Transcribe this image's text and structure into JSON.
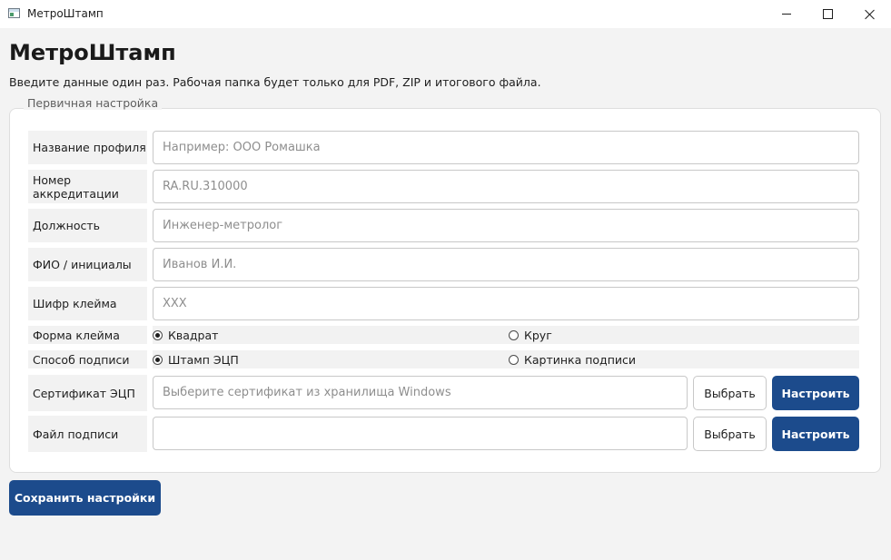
{
  "window": {
    "title": "МетроШтамп"
  },
  "header": {
    "title": "МетроШтамп",
    "subtitle": "Введите данные один раз. Рабочая папка будет только для PDF, ZIP и итогового файла."
  },
  "group": {
    "legend": "Первичная настройка"
  },
  "fields": {
    "profile": {
      "label": "Название профиля",
      "value": "",
      "placeholder": "Например: ООО Ромашка"
    },
    "accreditation": {
      "label": "Номер аккредитации",
      "value": "",
      "placeholder": "RA.RU.310000"
    },
    "position": {
      "label": "Должность",
      "value": "",
      "placeholder": "Инженер-метролог"
    },
    "name": {
      "label": "ФИО / инициалы",
      "value": "",
      "placeholder": "Иванов И.И."
    },
    "stamp_code": {
      "label": "Шифр клейма",
      "value": "",
      "placeholder": "XXX"
    }
  },
  "stamp_shape": {
    "label": "Форма клейма",
    "options": [
      {
        "label": "Квадрат",
        "checked": true
      },
      {
        "label": "Круг",
        "checked": false
      }
    ]
  },
  "sign_method": {
    "label": "Способ подписи",
    "options": [
      {
        "label": "Штамп ЭЦП",
        "checked": true
      },
      {
        "label": "Картинка подписи",
        "checked": false
      }
    ]
  },
  "certificate": {
    "label": "Сертификат ЭЦП",
    "placeholder": "Выберите сертификат из хранилища Windows",
    "choose_label": "Выбрать",
    "configure_label": "Настроить"
  },
  "signature_file": {
    "label": "Файл подписи",
    "value": "",
    "choose_label": "Выбрать",
    "configure_label": "Настроить"
  },
  "actions": {
    "save_label": "Сохранить настройки"
  },
  "colors": {
    "primary": "#1c4b8c",
    "background": "#f3f3f3",
    "label_bg": "#f2f2f2"
  }
}
